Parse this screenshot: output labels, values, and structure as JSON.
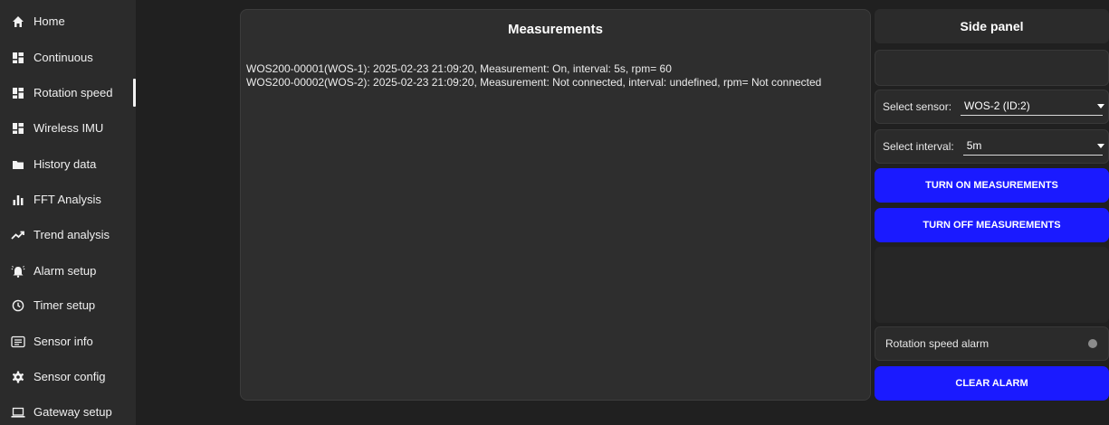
{
  "sidebar": {
    "items": [
      {
        "label": "Home",
        "icon": "home-icon"
      },
      {
        "label": "Continuous",
        "icon": "grid-icon"
      },
      {
        "label": "Rotation speed",
        "icon": "grid-icon",
        "active": true
      },
      {
        "label": "Wireless IMU",
        "icon": "grid-icon"
      },
      {
        "label": "History data",
        "icon": "folder-icon"
      },
      {
        "label": "FFT Analysis",
        "icon": "bar-chart-icon"
      },
      {
        "label": "Trend analysis",
        "icon": "trend-icon"
      },
      {
        "label": "Alarm setup",
        "icon": "alarm-bell-icon"
      },
      {
        "label": "Timer setup",
        "icon": "clock-icon"
      },
      {
        "label": "Sensor info",
        "icon": "info-card-icon"
      },
      {
        "label": "Sensor config",
        "icon": "gear-icon"
      },
      {
        "label": "Gateway setup",
        "icon": "laptop-icon"
      }
    ]
  },
  "measurements": {
    "title": "Measurements",
    "lines": [
      "WOS200-00001(WOS-1): 2025-02-23 21:09:20,  Measurement: On, interval: 5s,  rpm= 60",
      "WOS200-00002(WOS-2): 2025-02-23 21:09:20,  Measurement: Not connected, interval: undefined,  rpm= Not connected"
    ]
  },
  "side_panel": {
    "title": "Side panel",
    "sensor_label": "Select sensor:",
    "sensor_value": "WOS-2 (ID:2)",
    "interval_label": "Select interval:",
    "interval_value": "5m",
    "turn_on_label": "TURN ON MEASUREMENTS",
    "turn_off_label": "TURN OFF MEASUREMENTS",
    "alarm_label": "Rotation speed alarm",
    "clear_alarm_label": "CLEAR ALARM"
  },
  "colors": {
    "accent": "#1a1aff",
    "background": "#202020",
    "panel": "#2e2e2e",
    "alarm_indicator": "#8c8c8c"
  }
}
